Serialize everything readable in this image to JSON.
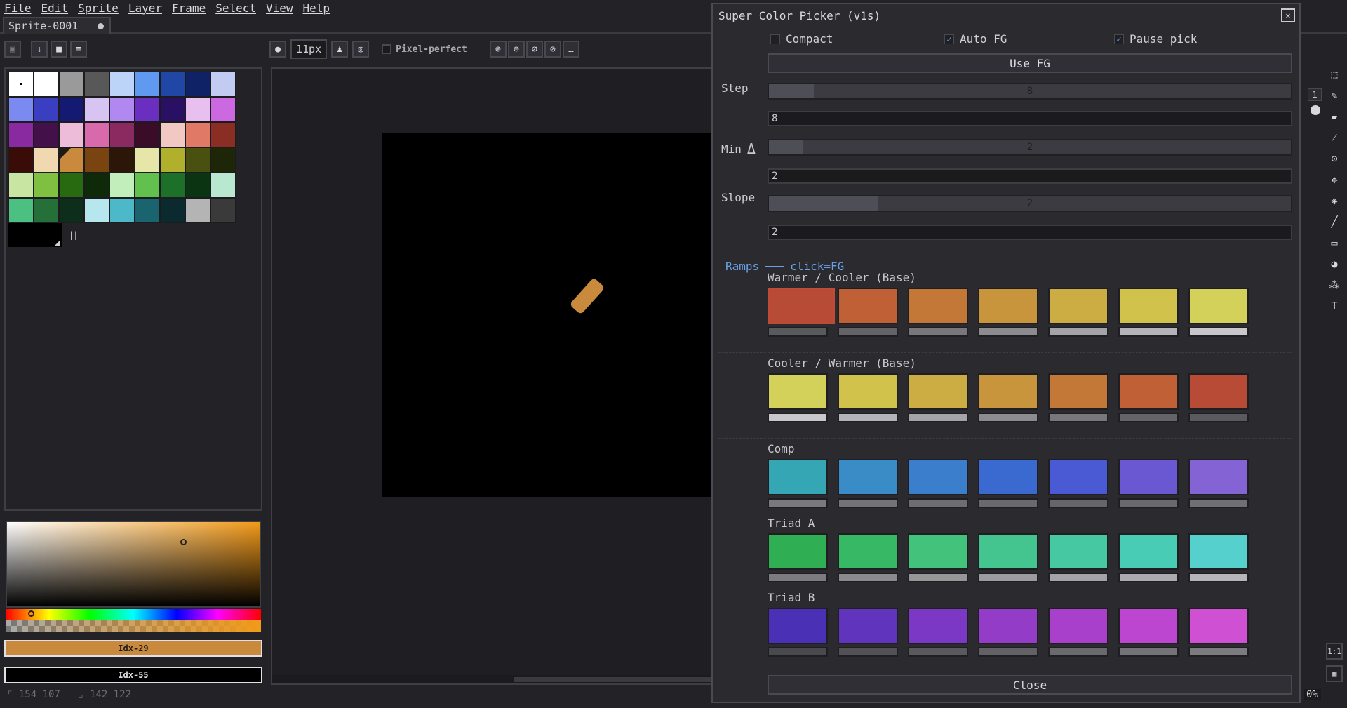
{
  "menu": [
    "File",
    "Edit",
    "Sprite",
    "Layer",
    "Frame",
    "Select",
    "View",
    "Help"
  ],
  "tab": {
    "title": "Sprite-0001"
  },
  "context_toolbar": {
    "brush_size": "11px",
    "pixel_perfect_label": "Pixel-perfect"
  },
  "palette": {
    "swatches": [
      "#ffffff",
      "#ffffff",
      "#9a9a9a",
      "#585858",
      "#bcd4f8",
      "#5f9af0",
      "#2046a6",
      "#102266",
      "#c2ccf2",
      "#7a8af0",
      "#3a3ec0",
      "#141a72",
      "#d8c4f2",
      "#b088f0",
      "#6a2ec0",
      "#2a1062",
      "#e8c0f0",
      "#cc68e0",
      "#8a2aa0",
      "#44104a",
      "#ecbcd8",
      "#d86aac",
      "#8a2a60",
      "#3a0c28",
      "#f2c8c2",
      "#e07a66",
      "#8a2e24",
      "#3a0c08",
      "#f0d8b0",
      "#c98a3e",
      "#7a4410",
      "#2c1608",
      "#e6e6a8",
      "#b0b02c",
      "#4a5010",
      "#1e2608",
      "#c8e6a2",
      "#80c040",
      "#286a10",
      "#0e2a08",
      "#c2eebc",
      "#62c04e",
      "#1c7028",
      "#0a3412",
      "#b8e8d0",
      "#4cc080",
      "#247038",
      "#0c2e1a",
      "#b6e6ee",
      "#4cb8c8",
      "#1a6470",
      "#0a2a30",
      "#b4b4b4",
      "#3a3a3a"
    ],
    "fg_label": "Idx-29",
    "bg_label": "Idx-55"
  },
  "status": {
    "position": "154  107",
    "size": "142  122"
  },
  "zoom_percent": "0%",
  "layer_indicator": "1",
  "dialog": {
    "title": "Super Color Picker (v1s)",
    "compact_label": "Compact",
    "auto_fg_label": "Auto FG",
    "pause_pick_label": "Pause pick",
    "use_fg_label": "Use FG",
    "step_label": "Step",
    "step_value": "8",
    "step_entry": "8",
    "min_label": "Min",
    "min_value": "2",
    "min_entry": "2",
    "slope_label": "Slope",
    "slope_value": "2",
    "slope_entry": "2",
    "ramps_label": "Ramps",
    "ramps_hint": "click=FG",
    "close_label": "Close",
    "ramps": [
      {
        "title": "Warmer / Cooler (Base)",
        "colors": [
          "#b84b35",
          "#bf6036",
          "#c47838",
          "#c8953c",
          "#ccad43",
          "#d0c24a",
          "#d3d159"
        ],
        "bars": [
          "#5a5a5e",
          "#646468",
          "#78787c",
          "#8c8c90",
          "#a4a4a8",
          "#b4b4b8",
          "#c8c8cc"
        ]
      },
      {
        "title": "Cooler / Warmer (Base)",
        "colors": [
          "#d3d159",
          "#d0c24a",
          "#ccad43",
          "#c8953c",
          "#c47838",
          "#bf6036",
          "#b84b35"
        ],
        "bars": [
          "#c8c8cc",
          "#b4b4b8",
          "#a4a4a8",
          "#8c8c90",
          "#78787c",
          "#646468",
          "#5a5a5e"
        ]
      },
      {
        "title": "Comp",
        "colors": [
          "#35a6b4",
          "#3a8cc6",
          "#3a7ecc",
          "#3a6ad0",
          "#4a5ad4",
          "#6a58d2",
          "#8464d4"
        ],
        "bars": [
          "#7a7a7e",
          "#747478",
          "#6e6e72",
          "#6a6a6e",
          "#66666a",
          "#6a6a6e",
          "#707074"
        ]
      },
      {
        "title": "Triad A",
        "colors": [
          "#2fae54",
          "#36b864",
          "#42c27a",
          "#44c48e",
          "#46c8a2",
          "#48ccb6",
          "#56d0cc"
        ],
        "bars": [
          "#7c7c80",
          "#8a8a8e",
          "#969698",
          "#9c9ca0",
          "#a4a4a8",
          "#acacb0",
          "#b6b6ba"
        ]
      },
      {
        "title": "Triad B",
        "colors": [
          "#4a30b4",
          "#6034bc",
          "#7a38c4",
          "#923cc8",
          "#a840cc",
          "#bc46d0",
          "#d050d4"
        ],
        "bars": [
          "#4a4a4e",
          "#525256",
          "#5a5a5e",
          "#626266",
          "#6a6a6e",
          "#747478",
          "#7c7c80"
        ]
      }
    ]
  }
}
